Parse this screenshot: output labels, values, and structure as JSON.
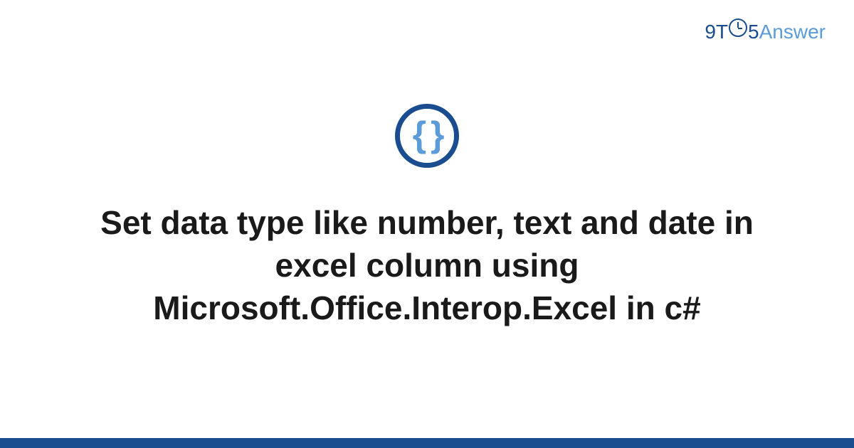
{
  "logo": {
    "part1": "9T",
    "part2": "5",
    "part3": "Answer"
  },
  "icon": {
    "braces": "{ }"
  },
  "main": {
    "title": "Set data type like number, text and date in excel column using Microsoft.Office.Interop.Excel in c#"
  }
}
